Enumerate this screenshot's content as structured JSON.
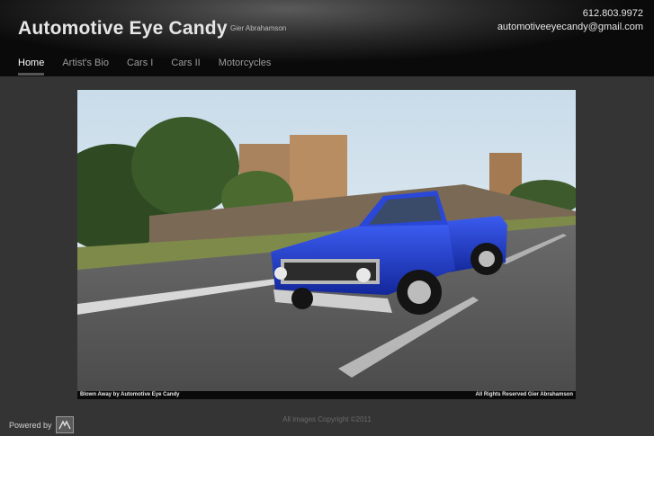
{
  "header": {
    "title": "Automotive Eye Candy",
    "subtitle": "Gier Abrahamson",
    "phone": "612.803.9972",
    "email": "automotiveeyecandy@gmail.com"
  },
  "nav": {
    "items": [
      {
        "label": "Home",
        "active": true
      },
      {
        "label": "Artist's Bio",
        "active": false
      },
      {
        "label": "Cars I",
        "active": false
      },
      {
        "label": "Cars II",
        "active": false
      },
      {
        "label": "Motorcycles",
        "active": false
      }
    ]
  },
  "photo": {
    "caption_left": "Blown Away by Automotive Eye Candy",
    "caption_right": "All Rights Reserved Gier Abrahamson"
  },
  "footer": {
    "powered_by": "Powered by",
    "powered_icon": "site-builder-logo-icon",
    "copyright": "All images Copyright ©2011"
  },
  "colors": {
    "header_bg": "#1a1a1a",
    "main_bg": "#343434",
    "truck": "#1f3fd6"
  }
}
